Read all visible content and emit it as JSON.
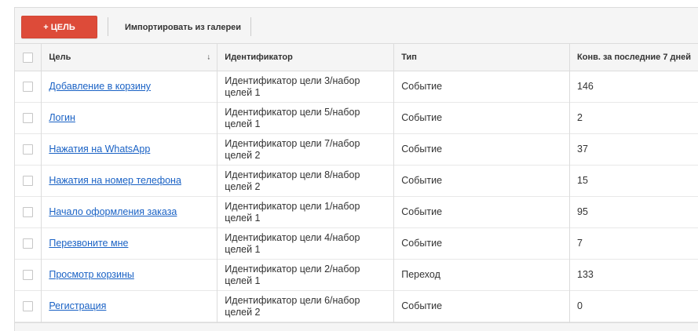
{
  "toolbar": {
    "add_label": "+ ЦЕЛЬ",
    "import_label": "Импортировать из галереи"
  },
  "table": {
    "columns": {
      "goal": "Цель",
      "identifier": "Идентификатор",
      "type": "Тип",
      "conversions": "Конв. за последние 7 дней"
    },
    "sort_icon": "↓",
    "rows": [
      {
        "name": "Добавление в корзину",
        "id_line1": "Идентификатор цели 3/набор",
        "id_line2": "целей 1",
        "type": "Событие",
        "conv": "146"
      },
      {
        "name": "Логин",
        "id_line1": "Идентификатор цели 5/набор",
        "id_line2": "целей 1",
        "type": "Событие",
        "conv": "2"
      },
      {
        "name": "Нажатия на WhatsApp",
        "id_line1": "Идентификатор цели 7/набор",
        "id_line2": "целей 2",
        "type": "Событие",
        "conv": "37"
      },
      {
        "name": "Нажатия на номер телефона",
        "id_line1": "Идентификатор цели 8/набор",
        "id_line2": "целей 2",
        "type": "Событие",
        "conv": "15"
      },
      {
        "name": "Начало оформления заказа",
        "id_line1": "Идентификатор цели 1/набор",
        "id_line2": "целей 1",
        "type": "Событие",
        "conv": "95"
      },
      {
        "name": "Перезвоните мне",
        "id_line1": "Идентификатор цели 4/набор",
        "id_line2": "целей 1",
        "type": "Событие",
        "conv": "7"
      },
      {
        "name": "Просмотр корзины",
        "id_line1": "Идентификатор цели 2/набор",
        "id_line2": "целей 1",
        "type": "Переход",
        "conv": "133"
      },
      {
        "name": "Регистрация",
        "id_line1": "Идентификатор цели 6/набор",
        "id_line2": "целей 2",
        "type": "Событие",
        "conv": "0"
      }
    ]
  },
  "colors": {
    "accent_button": "#dd4b39",
    "link": "#1a62c5",
    "header_bg": "#f5f5f5"
  }
}
